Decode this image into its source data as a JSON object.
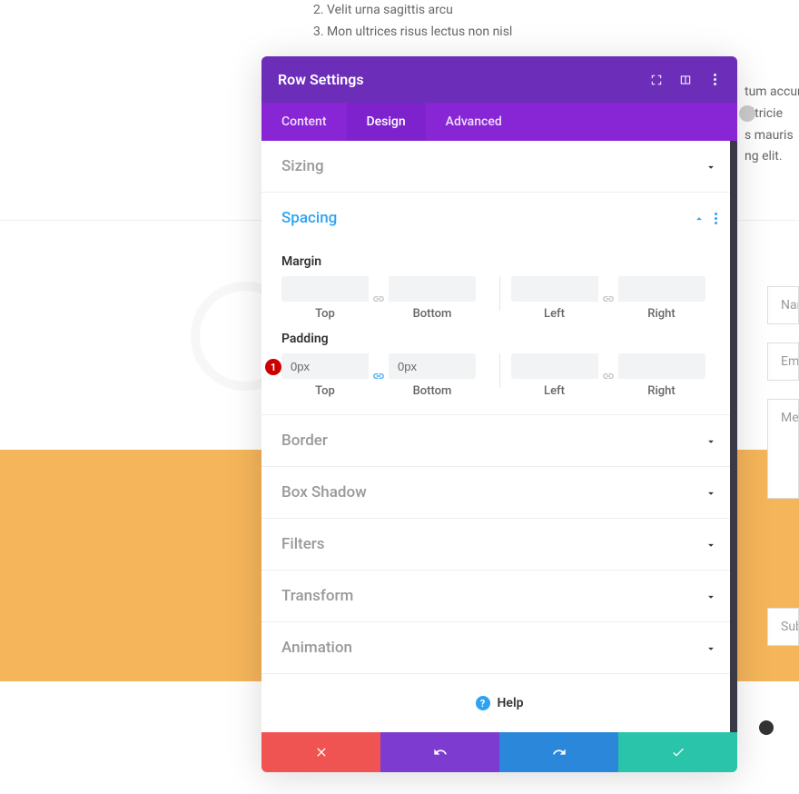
{
  "background": {
    "list_item_2": "Velit urna sagittis arcu",
    "list_item_3": "Mon ultrices risus lectus non nisl",
    "right_text_1": "tum accum",
    "right_text_2": "ultricie",
    "right_text_3": "s mauris",
    "right_text_4": "ng elit.",
    "form_name": "Nam",
    "form_email": "Ema",
    "form_message": "Mes",
    "form_subject": "Subj"
  },
  "modal": {
    "title": "Row Settings",
    "tabs": [
      {
        "label": "Content",
        "active": false
      },
      {
        "label": "Design",
        "active": true
      },
      {
        "label": "Advanced",
        "active": false
      }
    ],
    "sections": {
      "sizing": "Sizing",
      "spacing": "Spacing",
      "border": "Border",
      "box_shadow": "Box Shadow",
      "filters": "Filters",
      "transform": "Transform",
      "animation": "Animation"
    },
    "spacing": {
      "margin_label": "Margin",
      "padding_label": "Padding",
      "top": "Top",
      "bottom": "Bottom",
      "left": "Left",
      "right": "Right",
      "padding_top_value": "0px",
      "padding_bottom_value": "0px",
      "badge": "1"
    },
    "help": "Help"
  }
}
